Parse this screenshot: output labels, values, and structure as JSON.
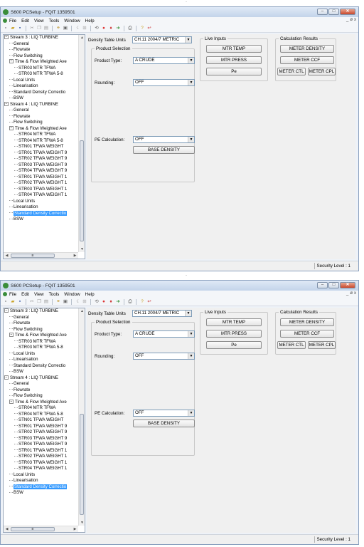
{
  "window": {
    "title": "S600 PCSetup - FQIT 1359501",
    "buttons": [
      "–",
      "□",
      "✕"
    ]
  },
  "menu": {
    "items": [
      "File",
      "Edit",
      "View",
      "Tools",
      "Window",
      "Help"
    ],
    "mdi_buttons": [
      "_",
      "ø",
      "x"
    ]
  },
  "tree": {
    "items": [
      {
        "text": "Stream 3 : LIQ TURBINE",
        "level": 0,
        "expander": "−",
        "selected": false
      },
      {
        "text": "General",
        "level": 1,
        "expander": "",
        "selected": false
      },
      {
        "text": "Flowrate",
        "level": 1,
        "expander": "",
        "selected": false
      },
      {
        "text": "Flow Switching",
        "level": 1,
        "expander": "",
        "selected": false
      },
      {
        "text": "Time & Flow Weighted Ave",
        "level": 1,
        "expander": "−",
        "selected": false
      },
      {
        "text": "STR03 MTR TFWA",
        "level": 2,
        "expander": "",
        "selected": false
      },
      {
        "text": "STR03 MTR TFWA 5-8",
        "level": 2,
        "expander": "",
        "selected": false
      },
      {
        "text": "Local Units",
        "level": 1,
        "expander": "",
        "selected": false
      },
      {
        "text": "Linearisation",
        "level": 1,
        "expander": "",
        "selected": false
      },
      {
        "text": "Standard Density Correctio",
        "level": 1,
        "expander": "",
        "selected": false
      },
      {
        "text": "BSW",
        "level": 1,
        "expander": "",
        "selected": false
      },
      {
        "text": "Stream 4 : LIQ TURBINE",
        "level": 0,
        "expander": "−",
        "selected": false
      },
      {
        "text": "General",
        "level": 1,
        "expander": "",
        "selected": false
      },
      {
        "text": "Flowrate",
        "level": 1,
        "expander": "",
        "selected": false
      },
      {
        "text": "Flow Switching",
        "level": 1,
        "expander": "",
        "selected": false
      },
      {
        "text": "Time & Flow Weighted Ave",
        "level": 1,
        "expander": "−",
        "selected": false
      },
      {
        "text": "STR04 MTR TFWA",
        "level": 2,
        "expander": "",
        "selected": false
      },
      {
        "text": "STR04 MTR TFWA 5-8",
        "level": 2,
        "expander": "",
        "selected": false
      },
      {
        "text": "STN01 TFWA WEIGHT",
        "level": 2,
        "expander": "",
        "selected": false
      },
      {
        "text": "STR01 TFWA WEIGHT 9",
        "level": 2,
        "expander": "",
        "selected": false
      },
      {
        "text": "STR02 TFWA WEIGHT 9",
        "level": 2,
        "expander": "",
        "selected": false
      },
      {
        "text": "STR03 TFWA WEIGHT 9",
        "level": 2,
        "expander": "",
        "selected": false
      },
      {
        "text": "STR04 TFWA WEIGHT 9",
        "level": 2,
        "expander": "",
        "selected": false
      },
      {
        "text": "STR01 TFWA WEIGHT 1",
        "level": 2,
        "expander": "",
        "selected": false
      },
      {
        "text": "STR02 TFWA WEIGHT 1",
        "level": 2,
        "expander": "",
        "selected": false
      },
      {
        "text": "STR03 TFWA WEIGHT 1",
        "level": 2,
        "expander": "",
        "selected": false
      },
      {
        "text": "STR04 TFWA WEIGHT 1",
        "level": 2,
        "expander": "",
        "selected": false
      },
      {
        "text": "Local Units",
        "level": 1,
        "expander": "",
        "selected": false
      },
      {
        "text": "Linearisation",
        "level": 1,
        "expander": "",
        "selected": false
      },
      {
        "text": "Standard Density Correctio",
        "level": 1,
        "expander": "",
        "selected": true
      },
      {
        "text": "BSW",
        "level": 1,
        "expander": "",
        "selected": false
      }
    ]
  },
  "form": {
    "density_table_label": "Density Table Units",
    "density_table_value": "CH.11 2004/7 METRIC",
    "product_selection_title": "Product Selection",
    "product_type_label": "Product Type:",
    "product_type_value": "A CRUDE",
    "rounding_label": "Rounding:",
    "rounding_value": "OFF",
    "pe_calc_label": "PE Calculation:",
    "pe_calc_value": "OFF",
    "base_density_button": "BASE DENSITY"
  },
  "live_inputs": {
    "title": "Live Inputs",
    "buttons": [
      "MTR TEMP",
      "MTR PRESS",
      "Pe"
    ]
  },
  "calc_results": {
    "title": "Calculation Results",
    "meter_density": "METER DENSITY",
    "meter_ccf": "METER CCF",
    "meter_ctl": "METER CTL",
    "meter_cpl": "METER CPL"
  },
  "status": {
    "security_level": "Security Level : 1"
  }
}
